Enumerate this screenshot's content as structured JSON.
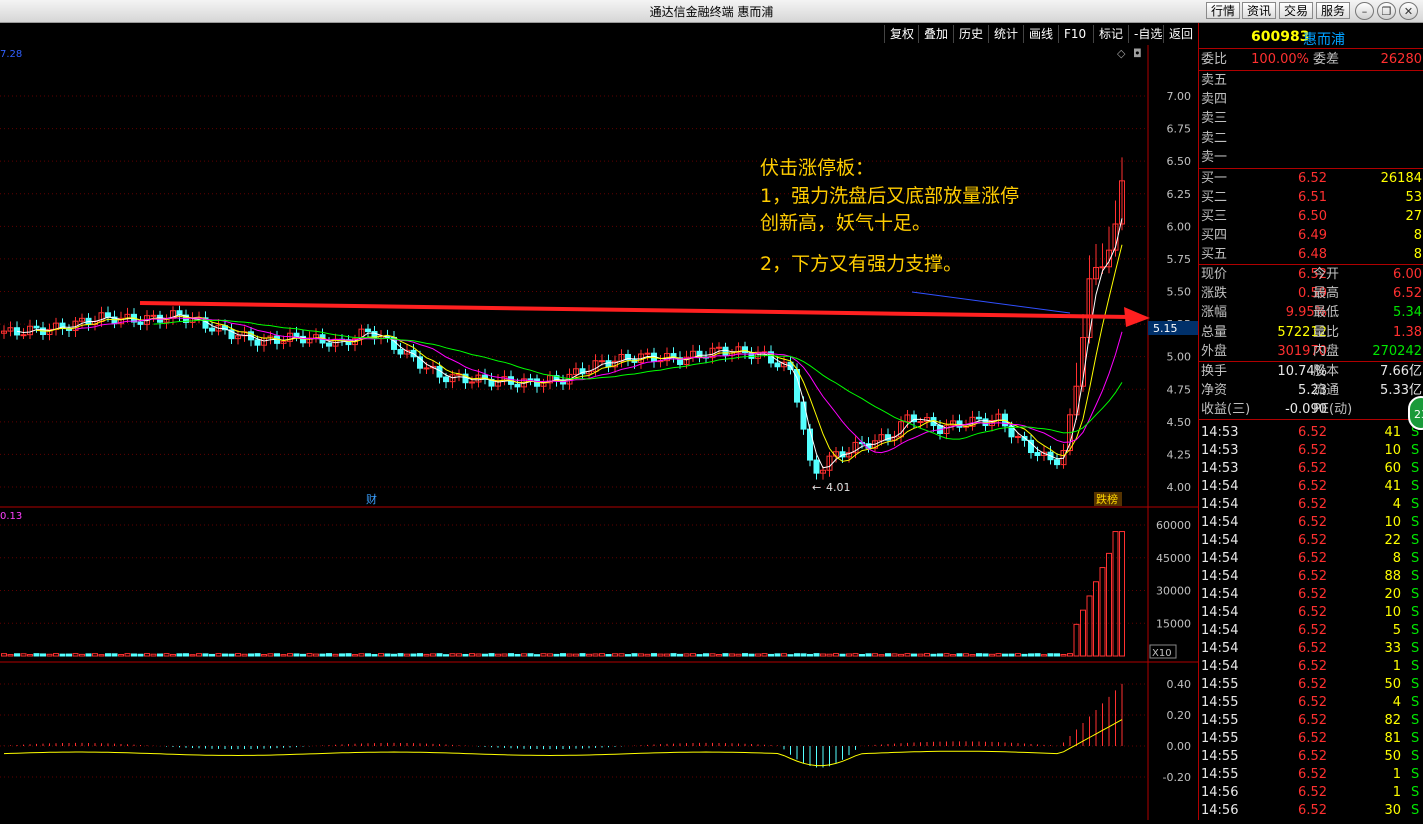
{
  "window": {
    "title": "通达信金融终端 惠而浦"
  },
  "titlebar_buttons": [
    "行情",
    "资讯",
    "交易",
    "服务"
  ],
  "toolbar": [
    "复权",
    "叠加",
    "历史",
    "统计",
    "画线",
    "F10",
    "标记",
    "-自选",
    "返回"
  ],
  "stock": {
    "code": "600983",
    "name": "惠而浦"
  },
  "order_book": {
    "weibi_label": "委比",
    "weibi": "100.00%",
    "weicha_label": "委差",
    "weicha": "26280",
    "asks": [
      {
        "label": "卖五"
      },
      {
        "label": "卖四"
      },
      {
        "label": "卖三"
      },
      {
        "label": "卖二"
      },
      {
        "label": "卖一"
      }
    ],
    "bids": [
      {
        "label": "买一",
        "price": "6.52",
        "vol": "26184"
      },
      {
        "label": "买二",
        "price": "6.51",
        "vol": "53"
      },
      {
        "label": "买三",
        "price": "6.50",
        "vol": "27"
      },
      {
        "label": "买四",
        "price": "6.49",
        "vol": "8"
      },
      {
        "label": "买五",
        "price": "6.48",
        "vol": "8"
      }
    ]
  },
  "quote": [
    {
      "l1": "现价",
      "v1": "6.52",
      "l2": "今开",
      "v2": "6.00"
    },
    {
      "l1": "涨跌",
      "v1": "0.59",
      "l2": "最高",
      "v2": "6.52"
    },
    {
      "l1": "涨幅",
      "v1": "9.95%",
      "l2": "最低",
      "v2": "5.34"
    },
    {
      "l1": "总量",
      "v1": "572212",
      "l2": "量比",
      "v2": "1.38"
    },
    {
      "l1": "外盘",
      "v1": "301970",
      "l2": "内盘",
      "v2": "270242"
    }
  ],
  "fundamentals": [
    {
      "l1": "换手",
      "v1": "10.74%",
      "l2": "股本",
      "v2": "7.66亿"
    },
    {
      "l1": "净资",
      "v1": "5.23",
      "l2": "流通",
      "v2": "5.33亿"
    },
    {
      "l1": "收益(三)",
      "v1": "-0.090",
      "l2": "PE(动)",
      "v2": "-"
    }
  ],
  "badge": "23",
  "ticks": [
    {
      "t": "14:53",
      "p": "6.52",
      "v": "41",
      "s": "S"
    },
    {
      "t": "14:53",
      "p": "6.52",
      "v": "10",
      "s": "S"
    },
    {
      "t": "14:53",
      "p": "6.52",
      "v": "60",
      "s": "S"
    },
    {
      "t": "14:54",
      "p": "6.52",
      "v": "41",
      "s": "S"
    },
    {
      "t": "14:54",
      "p": "6.52",
      "v": "4",
      "s": "S"
    },
    {
      "t": "14:54",
      "p": "6.52",
      "v": "10",
      "s": "S"
    },
    {
      "t": "14:54",
      "p": "6.52",
      "v": "22",
      "s": "S"
    },
    {
      "t": "14:54",
      "p": "6.52",
      "v": "8",
      "s": "S"
    },
    {
      "t": "14:54",
      "p": "6.52",
      "v": "88",
      "s": "S"
    },
    {
      "t": "14:54",
      "p": "6.52",
      "v": "20",
      "s": "S"
    },
    {
      "t": "14:54",
      "p": "6.52",
      "v": "10",
      "s": "S"
    },
    {
      "t": "14:54",
      "p": "6.52",
      "v": "5",
      "s": "S"
    },
    {
      "t": "14:54",
      "p": "6.52",
      "v": "33",
      "s": "S"
    },
    {
      "t": "14:54",
      "p": "6.52",
      "v": "1",
      "s": "S"
    },
    {
      "t": "14:55",
      "p": "6.52",
      "v": "50",
      "s": "S"
    },
    {
      "t": "14:55",
      "p": "6.52",
      "v": "4",
      "s": "S"
    },
    {
      "t": "14:55",
      "p": "6.52",
      "v": "82",
      "s": "S"
    },
    {
      "t": "14:55",
      "p": "6.52",
      "v": "81",
      "s": "S"
    },
    {
      "t": "14:55",
      "p": "6.52",
      "v": "50",
      "s": "S"
    },
    {
      "t": "14:55",
      "p": "6.52",
      "v": "1",
      "s": "S"
    },
    {
      "t": "14:56",
      "p": "6.52",
      "v": "1",
      "s": "S"
    },
    {
      "t": "14:56",
      "p": "6.52",
      "v": "30",
      "s": "S"
    }
  ],
  "chart": {
    "top_left_value": "7.28",
    "price_axis": [
      "7.00",
      "6.75",
      "6.50",
      "6.25",
      "6.00",
      "5.75",
      "5.50",
      "5.25",
      "5.00",
      "4.75",
      "4.50",
      "4.25",
      "4.00"
    ],
    "current_price_tag": "5.15",
    "low_label": "4.01",
    "cai_marker": "财",
    "dieband_marker": "跌榜",
    "volume_top_left": "0.13",
    "volume_axis": [
      "60000",
      "45000",
      "30000",
      "15000"
    ],
    "volume_unit": "X10",
    "macd_axis": [
      "0.40",
      "0.20",
      "0.00",
      "-0.20"
    ],
    "colors": {
      "up": "#ff3030",
      "down": "#54ffff",
      "ma5": "#ffffff",
      "ma10": "#ffff00",
      "ma20": "#ff00ff",
      "ma60": "#00ff00",
      "arrow": "#ff2020"
    }
  },
  "annotation": {
    "line1": "伏击涨停板：",
    "line2": "1，强力洗盘后又底部放量涨停",
    "line3": "创新高，妖气十足。",
    "line4": "2，下方又有强力支撑。"
  }
}
